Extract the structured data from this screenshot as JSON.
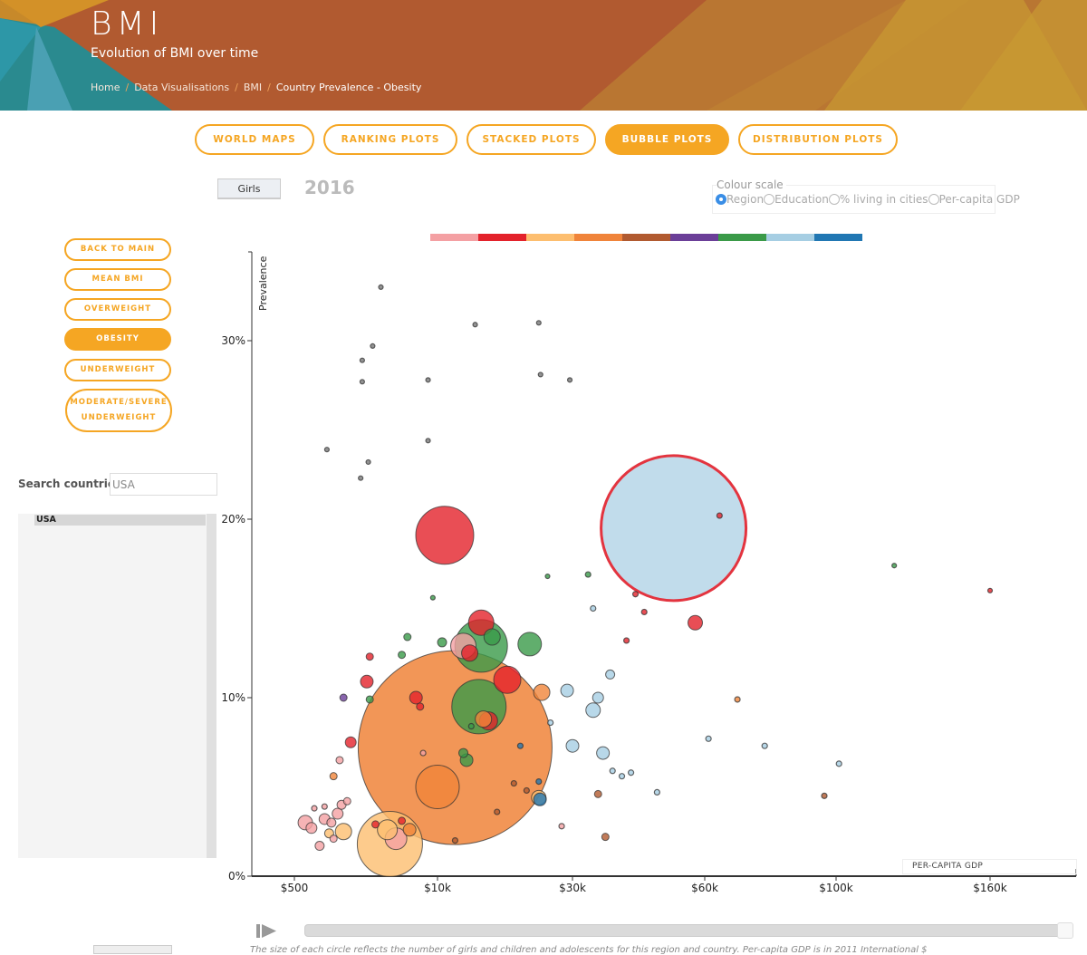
{
  "header": {
    "title": "BMI",
    "subtitle": "Evolution of BMI over time",
    "breadcrumb": [
      "Home",
      "Data Visualisations",
      "BMI",
      "Country Prevalence - Obesity"
    ],
    "separator": "/"
  },
  "tabs": [
    {
      "label": "WORLD MAPS",
      "active": false
    },
    {
      "label": "RANKING PLOTS",
      "active": false
    },
    {
      "label": "STACKED PLOTS",
      "active": false
    },
    {
      "label": "BUBBLE PLOTS",
      "active": true
    },
    {
      "label": "DISTRIBUTION PLOTS",
      "active": false
    }
  ],
  "controls": {
    "gender_button": "Girls",
    "year": "2016",
    "colour_scale": {
      "title": "Colour scale",
      "options": [
        "Region",
        "Education",
        "% living in cities",
        "Per-capita GDP"
      ],
      "selected": "Region"
    }
  },
  "sidebar": {
    "buttons": [
      {
        "label": "BACK TO MAIN",
        "active": false
      },
      {
        "label": "MEAN BMI",
        "active": false
      },
      {
        "label": "OVERWEIGHT",
        "active": false
      },
      {
        "label": "OBESITY",
        "active": true
      },
      {
        "label": "UNDERWEIGHT",
        "active": false
      },
      {
        "label": "MODERATE/SEVERE UNDERWEIGHT",
        "active": false
      }
    ],
    "search_label": "Search countries:",
    "search_value": "USA",
    "country_list": [
      "USA"
    ]
  },
  "colors": {
    "accent": "#f5a623",
    "region_palette": [
      "#f4a0a3",
      "#e3222b",
      "#fdbe6f",
      "#f0843a",
      "#b15a30",
      "#6b3f98",
      "#3a9a48",
      "#a6cee3",
      "#2177b3"
    ]
  },
  "chart_data": {
    "type": "scatter",
    "title": "Country Prevalence - Obesity (Girls, 2016)",
    "xlabel": "PER-CAPITA GDP",
    "ylabel": "Prevalence",
    "x_scale": "sqrt",
    "xlim": [
      0,
      200000
    ],
    "ylim": [
      0,
      35
    ],
    "x_ticks": [
      500,
      10000,
      30000,
      60000,
      100000,
      160000
    ],
    "x_tick_labels": [
      "$500",
      "$10k",
      "$30k",
      "$60k",
      "$100k",
      "$160k"
    ],
    "y_ticks": [
      0,
      10,
      20,
      30
    ],
    "y_tick_labels": [
      "0%",
      "10%",
      "20%",
      "30%"
    ],
    "size_meaning": "number of girls (population)",
    "highlighted_country": "USA",
    "points": [
      {
        "x": 52000,
        "y": 19.5,
        "r": 80,
        "c": 7,
        "highlight": true
      },
      {
        "x": 12000,
        "y": 7.2,
        "r": 107,
        "c": 3
      },
      {
        "x": 5500,
        "y": 1.8,
        "r": 36,
        "c": 2
      },
      {
        "x": 10800,
        "y": 19.1,
        "r": 32,
        "c": 1
      },
      {
        "x": 15000,
        "y": 9.5,
        "r": 30,
        "c": 6
      },
      {
        "x": 15300,
        "y": 12.9,
        "r": 29,
        "c": 6
      },
      {
        "x": 10000,
        "y": 5.0,
        "r": 24,
        "c": 3
      },
      {
        "x": 19000,
        "y": 11.0,
        "r": 15,
        "c": 1
      },
      {
        "x": 15300,
        "y": 14.2,
        "r": 14,
        "c": 1
      },
      {
        "x": 13000,
        "y": 12.9,
        "r": 14,
        "c": 0
      },
      {
        "x": 22500,
        "y": 13.0,
        "r": 13,
        "c": 6
      },
      {
        "x": 57500,
        "y": 14.2,
        "r": 8,
        "c": 1
      },
      {
        "x": 6000,
        "y": 2.1,
        "r": 12,
        "c": 0
      },
      {
        "x": 5300,
        "y": 2.6,
        "r": 11,
        "c": 2
      },
      {
        "x": 2400,
        "y": 2.5,
        "r": 9,
        "c": 2
      },
      {
        "x": 13800,
        "y": 12.5,
        "r": 9,
        "c": 1
      },
      {
        "x": 16800,
        "y": 13.4,
        "r": 9,
        "c": 6
      },
      {
        "x": 16300,
        "y": 8.7,
        "r": 10,
        "c": 1
      },
      {
        "x": 15600,
        "y": 8.8,
        "r": 9,
        "c": 3
      },
      {
        "x": 24500,
        "y": 10.3,
        "r": 9,
        "c": 3
      },
      {
        "x": 7800,
        "y": 10.0,
        "r": 7,
        "c": 1
      },
      {
        "x": 3800,
        "y": 10.9,
        "r": 7,
        "c": 1
      },
      {
        "x": 2800,
        "y": 7.5,
        "r": 6,
        "c": 1
      },
      {
        "x": 7200,
        "y": 2.6,
        "r": 7,
        "c": 3
      },
      {
        "x": 30000,
        "y": 7.3,
        "r": 7,
        "c": 7
      },
      {
        "x": 34000,
        "y": 9.3,
        "r": 8,
        "c": 7
      },
      {
        "x": 29000,
        "y": 10.4,
        "r": 7,
        "c": 7
      },
      {
        "x": 36000,
        "y": 6.9,
        "r": 7,
        "c": 7
      },
      {
        "x": 35000,
        "y": 10.0,
        "r": 6,
        "c": 7
      },
      {
        "x": 37500,
        "y": 11.3,
        "r": 5,
        "c": 7
      },
      {
        "x": 24000,
        "y": 4.4,
        "r": 8,
        "c": 2
      },
      {
        "x": 24200,
        "y": 4.3,
        "r": 7,
        "c": 8
      },
      {
        "x": 10500,
        "y": 13.1,
        "r": 5,
        "c": 6
      },
      {
        "x": 13400,
        "y": 6.5,
        "r": 7,
        "c": 6
      },
      {
        "x": 13000,
        "y": 6.9,
        "r": 5,
        "c": 6
      },
      {
        "x": 6500,
        "y": 12.4,
        "r": 4,
        "c": 6
      },
      {
        "x": 7000,
        "y": 13.4,
        "r": 4,
        "c": 6
      },
      {
        "x": 4000,
        "y": 9.9,
        "r": 4,
        "c": 6
      },
      {
        "x": 4000,
        "y": 12.3,
        "r": 4,
        "c": 1
      },
      {
        "x": 8200,
        "y": 9.5,
        "r": 4,
        "c": 1
      },
      {
        "x": 2400,
        "y": 10.0,
        "r": 4,
        "c": 5
      },
      {
        "x": 2200,
        "y": 6.5,
        "r": 4,
        "c": 0
      },
      {
        "x": 1900,
        "y": 5.6,
        "r": 4,
        "c": 3
      },
      {
        "x": 35000,
        "y": 4.6,
        "r": 4,
        "c": 4
      },
      {
        "x": 36500,
        "y": 2.2,
        "r": 4,
        "c": 4
      },
      {
        "x": 69000,
        "y": 9.9,
        "r": 3,
        "c": 3
      },
      {
        "x": 96000,
        "y": 4.5,
        "r": 3,
        "c": 4
      },
      {
        "x": 61000,
        "y": 7.7,
        "r": 3,
        "c": 7
      },
      {
        "x": 77000,
        "y": 7.3,
        "r": 3,
        "c": 7
      },
      {
        "x": 101000,
        "y": 6.3,
        "r": 3,
        "c": 7
      },
      {
        "x": 48000,
        "y": 4.7,
        "r": 3,
        "c": 7
      },
      {
        "x": 64000,
        "y": 20.2,
        "r": 3,
        "c": 1
      },
      {
        "x": 43000,
        "y": 15.8,
        "r": 3,
        "c": 1
      },
      {
        "x": 45000,
        "y": 14.8,
        "r": 3,
        "c": 1
      },
      {
        "x": 41000,
        "y": 13.2,
        "r": 3,
        "c": 1
      },
      {
        "x": 33000,
        "y": 16.9,
        "r": 3,
        "c": 6
      },
      {
        "x": 34000,
        "y": 15.0,
        "r": 3,
        "c": 7
      },
      {
        "x": 121000,
        "y": 17.4,
        "r": 2.5,
        "c": 6
      },
      {
        "x": 160000,
        "y": 16.0,
        "r": 2.5,
        "c": 1
      },
      {
        "x": 25500,
        "y": 16.8,
        "r": 2.5,
        "c": 6
      },
      {
        "x": 9500,
        "y": 15.6,
        "r": 2.5,
        "c": 6
      },
      {
        "x": 4800,
        "y": 33.0,
        "r": 2.5,
        "c": 5
      },
      {
        "x": 14500,
        "y": 30.9,
        "r": 2.5,
        "c": 5
      },
      {
        "x": 24000,
        "y": 31.0,
        "r": 2.5,
        "c": 5
      },
      {
        "x": 4200,
        "y": 29.7,
        "r": 2.5,
        "c": 5
      },
      {
        "x": 3500,
        "y": 28.9,
        "r": 2.5,
        "c": 5
      },
      {
        "x": 3500,
        "y": 27.7,
        "r": 2.5,
        "c": 5
      },
      {
        "x": 9000,
        "y": 27.8,
        "r": 2.5,
        "c": 5
      },
      {
        "x": 24300,
        "y": 28.1,
        "r": 2.5,
        "c": 5
      },
      {
        "x": 29500,
        "y": 27.8,
        "r": 2.5,
        "c": 5
      },
      {
        "x": 9000,
        "y": 24.4,
        "r": 2.5,
        "c": 5
      },
      {
        "x": 1600,
        "y": 23.9,
        "r": 2.5,
        "c": 5
      },
      {
        "x": 3900,
        "y": 23.2,
        "r": 2.5,
        "c": 5
      },
      {
        "x": 3400,
        "y": 22.3,
        "r": 2.5,
        "c": 5
      },
      {
        "x": 800,
        "y": 3.0,
        "r": 8,
        "c": 0
      },
      {
        "x": 1000,
        "y": 2.7,
        "r": 6,
        "c": 0
      },
      {
        "x": 1500,
        "y": 3.2,
        "r": 6,
        "c": 0
      },
      {
        "x": 1800,
        "y": 3.0,
        "r": 5,
        "c": 0
      },
      {
        "x": 2100,
        "y": 3.5,
        "r": 6,
        "c": 0
      },
      {
        "x": 2300,
        "y": 4.0,
        "r": 5,
        "c": 0
      },
      {
        "x": 1300,
        "y": 1.7,
        "r": 5,
        "c": 0
      },
      {
        "x": 1100,
        "y": 3.8,
        "r": 3,
        "c": 0
      },
      {
        "x": 1500,
        "y": 3.9,
        "r": 3,
        "c": 0
      },
      {
        "x": 1700,
        "y": 2.4,
        "r": 5,
        "c": 2
      },
      {
        "x": 2600,
        "y": 4.2,
        "r": 4,
        "c": 0
      },
      {
        "x": 1900,
        "y": 2.1,
        "r": 4,
        "c": 0
      },
      {
        "x": 4400,
        "y": 2.9,
        "r": 4,
        "c": 1
      },
      {
        "x": 6500,
        "y": 3.1,
        "r": 4,
        "c": 1
      },
      {
        "x": 17500,
        "y": 3.6,
        "r": 3,
        "c": 4
      },
      {
        "x": 12000,
        "y": 2.0,
        "r": 3,
        "c": 4
      },
      {
        "x": 20000,
        "y": 5.2,
        "r": 3,
        "c": 4
      },
      {
        "x": 22000,
        "y": 4.8,
        "r": 3,
        "c": 4
      },
      {
        "x": 14000,
        "y": 8.4,
        "r": 3,
        "c": 6
      },
      {
        "x": 8500,
        "y": 6.9,
        "r": 3,
        "c": 0
      },
      {
        "x": 28000,
        "y": 2.8,
        "r": 3,
        "c": 0
      },
      {
        "x": 42000,
        "y": 5.8,
        "r": 3,
        "c": 7
      },
      {
        "x": 40000,
        "y": 5.6,
        "r": 3,
        "c": 7
      },
      {
        "x": 38000,
        "y": 5.9,
        "r": 3,
        "c": 7
      },
      {
        "x": 26000,
        "y": 8.6,
        "r": 3,
        "c": 7
      },
      {
        "x": 24000,
        "y": 5.3,
        "r": 3,
        "c": 8
      },
      {
        "x": 21000,
        "y": 7.3,
        "r": 3,
        "c": 8
      }
    ]
  },
  "timeline": {
    "play_icon": "play-icon",
    "progress": 1.0
  },
  "footer": {
    "caption": "The size of each circle reflects the number of girls and children and adolescents for this region and country. Per-capita GDP is in 2011 International $"
  }
}
